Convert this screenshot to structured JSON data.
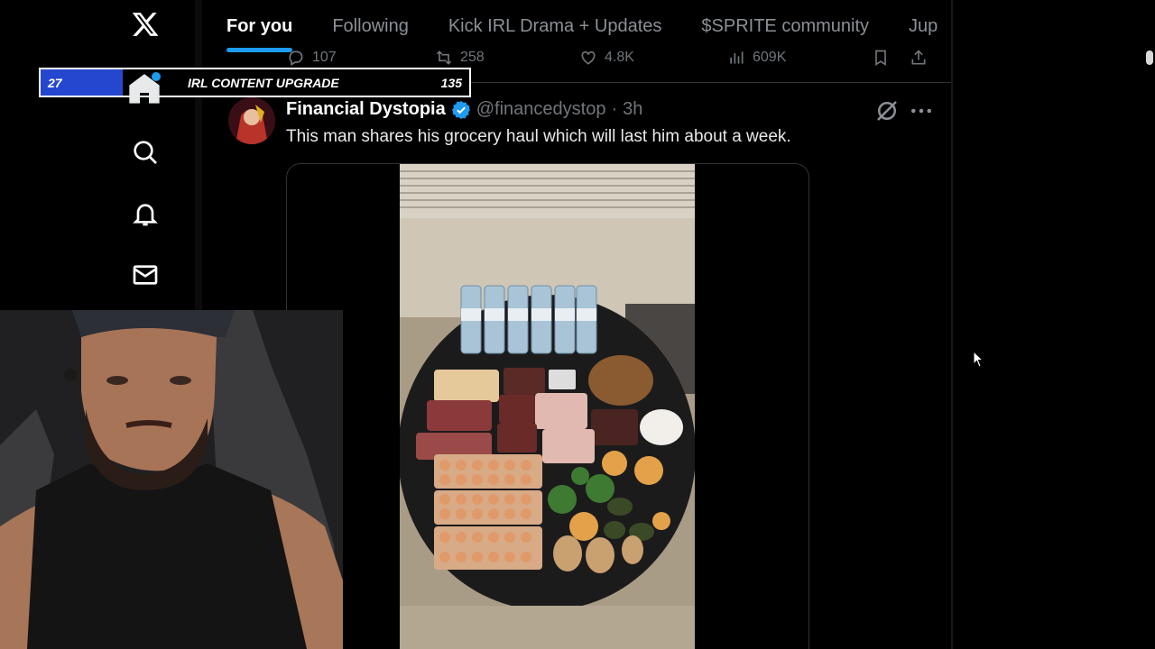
{
  "tabs": [
    {
      "label": "For you",
      "active": true
    },
    {
      "label": "Following",
      "active": false
    },
    {
      "label": "Kick IRL Drama + Updates",
      "active": false
    },
    {
      "label": "$SPRITE community",
      "active": false
    },
    {
      "label": "Jup",
      "active": false
    }
  ],
  "prev_tweet_actions": {
    "replies": "107",
    "reposts": "258",
    "likes": "4.8K",
    "views": "609K"
  },
  "overlay": {
    "current": "27",
    "title": "IRL CONTENT UPGRADE",
    "goal": "135"
  },
  "tweet": {
    "author_name": "Financial Dystopia",
    "handle": "@financedystop",
    "separator": "·",
    "time": "3h",
    "text": "This man shares his grocery haul which will last him about a week."
  },
  "icons": {
    "logo": "x-logo-icon",
    "home": "home-icon",
    "search": "search-icon",
    "notifications": "bell-icon",
    "messages": "mail-icon"
  },
  "colors": {
    "accent": "#1d9bf0",
    "overlay_bar": "#2547d0"
  }
}
